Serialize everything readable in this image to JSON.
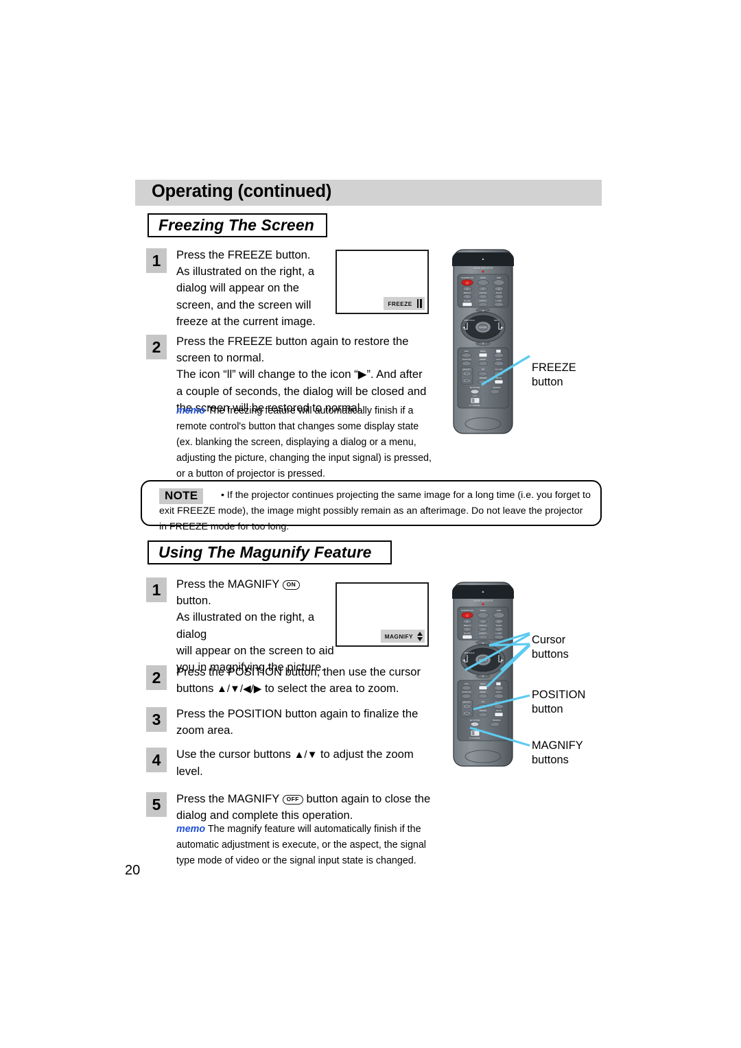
{
  "header": {
    "title": "Operating (continued)"
  },
  "sections": {
    "freeze": {
      "title": "Freezing The Screen"
    },
    "magnify": {
      "title": "Using The Magunify Feature"
    }
  },
  "freeze_steps": [
    {
      "num": "1",
      "text": "Press the FREEZE button.\nAs illustrated on the right, a\ndialog will appear on the\nscreen, and the screen will\nfreeze at the current image."
    },
    {
      "num": "2",
      "text": "Press the FREEZE button again to restore the\nscreen to normal.\nThe icon “ll” will change to the icon “▶”.  And after\na couple of seconds, the dialog will be closed and\nthe screen will be restored to normal."
    }
  ],
  "freeze_memo": {
    "tag": "memo",
    "text": " The freezing feature will automatically finish if a remote control's button that changes some display state (ex. blanking the screen, displaying a dialog or a menu, adjusting the picture, changing the input signal) is pressed, or a button of projector is pressed."
  },
  "note": {
    "tag": "NOTE",
    "text": "• If the projector continues projecting the same image for a long time (i.e. you forget to exit FREEZE mode), the image might possibly remain as an afterimage. Do not leave the projector in FREEZE mode for too long."
  },
  "magnify_steps": [
    {
      "num": "1",
      "line1_pre": "Press the MAGNIFY ",
      "pill": "ON",
      "line1_post": "",
      "rest": "button.\nAs illustrated on the right, a dialog\nwill appear on the screen to aid\nyou in magnifying the picture."
    },
    {
      "num": "2",
      "line1": "Press the POSITION button, then use the cursor",
      "line2_pre": "buttons ",
      "arrows": "▲/▼/◀/▶",
      "line2_post": " to select the area to zoom."
    },
    {
      "num": "3",
      "text": "Press the POSITION button again to finalize the\nzoom area."
    },
    {
      "num": "4",
      "line1_pre": "Use the cursor buttons ",
      "arrows": "▲/▼",
      "line1_post": " to adjust the zoom",
      "line2": "level."
    },
    {
      "num": "5",
      "line1_pre": "Press the MAGNIFY ",
      "pill": "OFF",
      "line1_post": " button again to close the",
      "line2": "dialog and complete this operation."
    }
  ],
  "magnify_memo": {
    "tag": "memo",
    "text": " The magnify feature will automatically finish if the automatic adjustment is execute, or the aspect, the signal type mode of video or the signal input state is changed."
  },
  "osd": {
    "freeze_label": "FREEZE",
    "magnify_label": "MAGNIFY"
  },
  "callouts": {
    "freeze_button": "FREEZE\nbutton",
    "cursor_buttons": "Cursor\nbuttons",
    "position_button": "POSITION\nbutton",
    "magnify_buttons": "MAGNIFY\nbuttons"
  },
  "remote_buttons": {
    "row1": [
      "STANDBY/ON",
      "VIDEO",
      "RGB"
    ],
    "row2": [
      "BRIGHT",
      "FOCUS",
      "ZOOM"
    ],
    "row3": [
      "BLANK",
      "ASPECT",
      "LASER"
    ],
    "pad": [
      "PREVIOUS",
      "NEXT",
      "ENTER"
    ],
    "row4": [
      "ESC",
      "MENU",
      ""
    ],
    "row5": [
      "POSITION",
      "RESET",
      "AUTO"
    ],
    "row6": [
      "MAGNIFY",
      "PIP",
      "VOLUME"
    ],
    "row7": [
      "ON",
      "FREEZE",
      "MUTE"
    ],
    "row8": [
      "OFF",
      "",
      ""
    ],
    "row9": [
      "KEYSTONE",
      "SEARCH"
    ],
    "switch": "ID CHANGE",
    "switch_digits": "1 2 3",
    "top_label": "LASER INDICATOR"
  },
  "page_number": "20",
  "colors": {
    "header_bg": "#d2d2d2",
    "step_badge": "#c6c6c6",
    "memo_blue": "#1f4fd8",
    "callout_line": "#5ecbf0",
    "remote_body": "#5a6066",
    "power_red": "#e01b1b"
  }
}
